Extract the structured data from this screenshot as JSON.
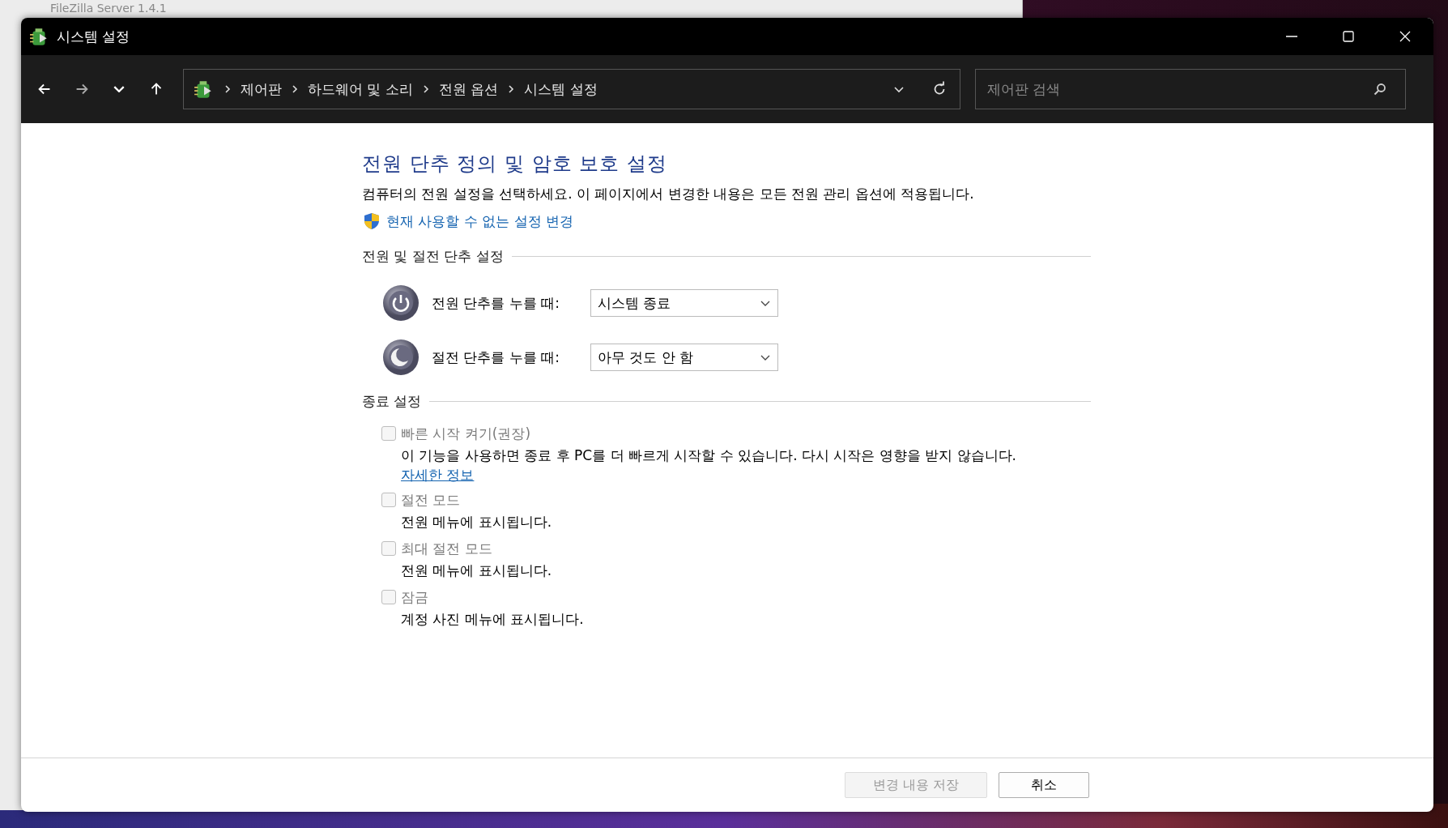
{
  "background_window": {
    "title": "FileZilla Server 1.4.1"
  },
  "window": {
    "title": "시스템 설정"
  },
  "nav": {
    "breadcrumb": [
      "제어판",
      "하드웨어 및 소리",
      "전원 옵션",
      "시스템 설정"
    ],
    "search": {
      "placeholder": "제어판 검색"
    }
  },
  "page": {
    "heading": "전원 단추 정의 및 암호 보호 설정",
    "description": "컴퓨터의 전원 설정을 선택하세요. 이 페이지에서 변경한 내용은 모든 전원 관리 옵션에 적용됩니다.",
    "admin_link": "현재 사용할 수 없는 설정 변경",
    "button_section": {
      "title": "전원 및 절전 단추 설정",
      "rows": [
        {
          "kind": "power",
          "label": "전원 단추를 누를 때:",
          "value": "시스템 종료"
        },
        {
          "kind": "sleep",
          "label": "절전 단추를 누를 때:",
          "value": "아무 것도 안 함"
        }
      ]
    },
    "shutdown_section": {
      "title": "종료 설정",
      "options": [
        {
          "label": "빠른 시작 켜기(권장)",
          "checked": false,
          "disabled": true,
          "description": "이 기능을 사용하면 종료 후 PC를 더 빠르게 시작할 수 있습니다. 다시 시작은 영향을 받지 않습니다.",
          "link": "자세한 정보"
        },
        {
          "label": "절전 모드",
          "checked": false,
          "disabled": true,
          "description": "전원 메뉴에 표시됩니다."
        },
        {
          "label": "최대 절전 모드",
          "checked": false,
          "disabled": true,
          "description": "전원 메뉴에 표시됩니다."
        },
        {
          "label": "잠금",
          "checked": false,
          "disabled": true,
          "description": "계정 사진 메뉴에 표시됩니다."
        }
      ]
    }
  },
  "buttons": [
    {
      "label": "변경 내용 저장",
      "disabled": true
    },
    {
      "label": "취소",
      "disabled": false
    }
  ]
}
